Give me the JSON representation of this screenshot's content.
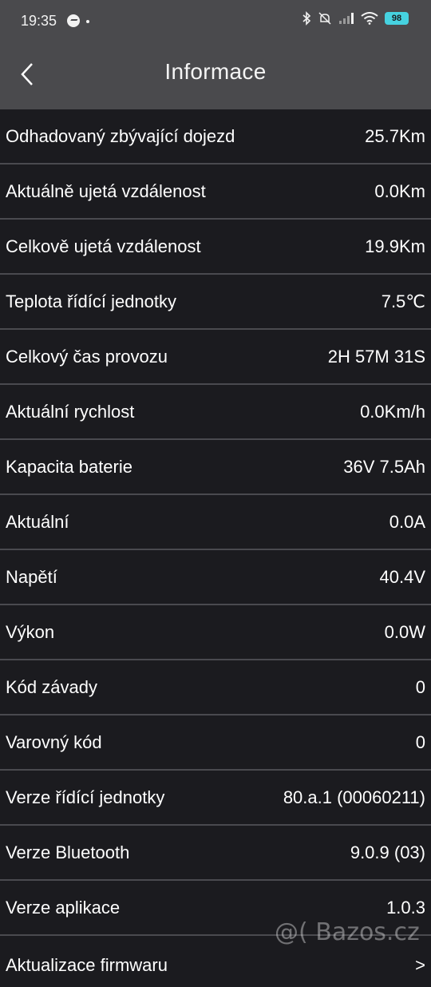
{
  "status_bar": {
    "time": "19:35",
    "battery": "98"
  },
  "header": {
    "title": "Informace"
  },
  "rows": [
    {
      "label": "Odhadovaný zbývající dojezd",
      "value": "25.7Km"
    },
    {
      "label": "Aktuálně ujetá vzdálenost",
      "value": "0.0Km"
    },
    {
      "label": "Celkově ujetá vzdálenost",
      "value": "19.9Km"
    },
    {
      "label": "Teplota řídící jednotky",
      "value": "7.5℃"
    },
    {
      "label": "Celkový čas provozu",
      "value": "2H 57M 31S"
    },
    {
      "label": "Aktuální rychlost",
      "value": "0.0Km/h"
    },
    {
      "label": "Kapacita baterie",
      "value": "36V 7.5Ah"
    },
    {
      "label": "Aktuální",
      "value": "0.0A"
    },
    {
      "label": "Napětí",
      "value": "40.4V"
    },
    {
      "label": "Výkon",
      "value": "0.0W"
    },
    {
      "label": "Kód závady",
      "value": "0"
    },
    {
      "label": "Varovný kód",
      "value": "0"
    },
    {
      "label": "Verze řídící jednotky",
      "value": "80.a.1 (00060211)"
    },
    {
      "label": "Verze Bluetooth",
      "value": "9.0.9 (03)"
    },
    {
      "label": "Verze aplikace",
      "value": "1.0.3"
    }
  ],
  "firmware_row": {
    "label": "Aktualizace firmwaru",
    "chevron": ">"
  },
  "watermark": "@( Bazos.cz"
}
